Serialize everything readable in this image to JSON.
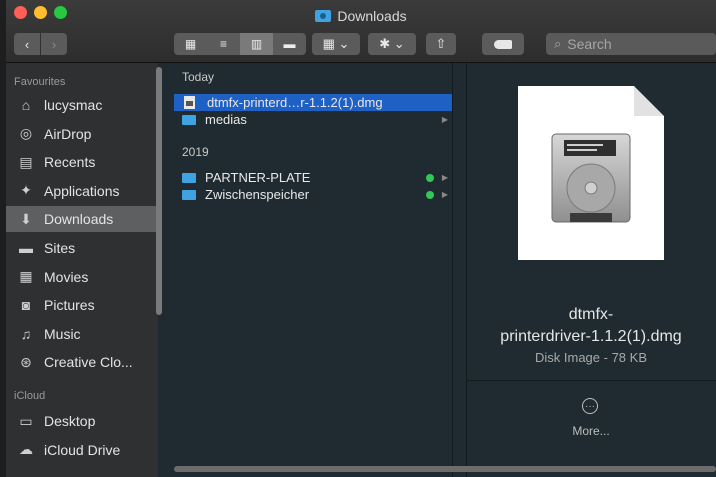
{
  "window": {
    "title": "Downloads"
  },
  "toolbar": {
    "back": "‹",
    "forward": "›",
    "view_icons": [
      "▦",
      "≡",
      "▥",
      "▬"
    ],
    "group_label": "▦ ⌄",
    "action_label": "✱ ⌄",
    "share_label": "⇧",
    "search_placeholder": "Search"
  },
  "sidebar": {
    "favourites_label": "Favourites",
    "icloud_label": "iCloud",
    "favourites": [
      {
        "label": "lucysmac",
        "icon": "home-icon"
      },
      {
        "label": "AirDrop",
        "icon": "airdrop-icon"
      },
      {
        "label": "Recents",
        "icon": "recents-icon"
      },
      {
        "label": "Applications",
        "icon": "applications-icon"
      },
      {
        "label": "Downloads",
        "icon": "downloads-icon",
        "selected": true
      },
      {
        "label": "Sites",
        "icon": "folder-icon"
      },
      {
        "label": "Movies",
        "icon": "movies-icon"
      },
      {
        "label": "Pictures",
        "icon": "pictures-icon"
      },
      {
        "label": "Music",
        "icon": "music-icon"
      },
      {
        "label": "Creative Clo...",
        "icon": "creative-cloud-icon"
      }
    ],
    "icloud": [
      {
        "label": "Desktop",
        "icon": "desktop-icon"
      },
      {
        "label": "iCloud Drive",
        "icon": "cloud-icon"
      }
    ]
  },
  "column": {
    "groups": [
      {
        "label": "Today",
        "items": [
          {
            "name": "dtmfx-printerd…r-1.1.2(1).dmg",
            "kind": "file",
            "selected": true
          },
          {
            "name": "medias",
            "kind": "folder"
          }
        ]
      },
      {
        "label": "2019",
        "items": [
          {
            "name": "PARTNER-PLATE",
            "kind": "folder",
            "tag": "#32c759"
          },
          {
            "name": "Zwischenspeicher",
            "kind": "folder",
            "tag": "#32c759"
          }
        ]
      }
    ]
  },
  "preview": {
    "name_line1": "dtmfx-",
    "name_line2": "printerdriver-1.1.2(1).dmg",
    "kind": "Disk Image - 78 KB",
    "more_label": "More..."
  },
  "colors": {
    "selection": "#1f60c4",
    "folder": "#3ea3e0",
    "tag_green": "#32c759"
  }
}
